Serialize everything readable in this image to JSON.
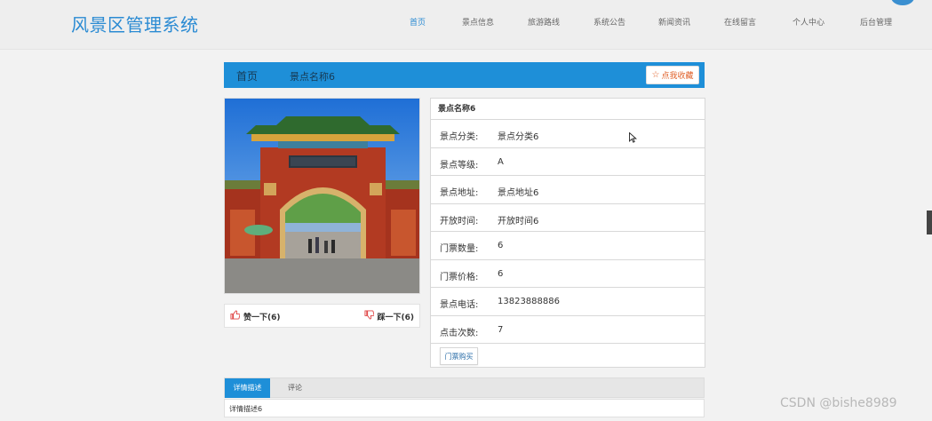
{
  "header": {
    "logo": "风景区管理系统",
    "nav": [
      {
        "label": "首页",
        "active": true
      },
      {
        "label": "景点信息",
        "active": false
      },
      {
        "label": "旅游路线",
        "active": false
      },
      {
        "label": "系统公告",
        "active": false
      },
      {
        "label": "新闻资讯",
        "active": false
      },
      {
        "label": "在线留言",
        "active": false
      },
      {
        "label": "个人中心",
        "active": false
      },
      {
        "label": "后台管理",
        "active": false
      }
    ],
    "accent_color": "#2b8bd3"
  },
  "breadcrumb": {
    "home": "首页",
    "current": "景点名称6",
    "favorite_label": "点我收藏",
    "favorite_icon": "star-outline-icon",
    "bar_color": "#1e8fd8"
  },
  "likes": {
    "like_label": "赞一下(6)",
    "like_icon": "thumbs-up-icon",
    "dislike_label": "踩一下(6)",
    "dislike_icon": "thumbs-down-icon"
  },
  "info": {
    "title": "景点名称6",
    "rows": [
      {
        "key": "景点分类:",
        "value": "景点分类6"
      },
      {
        "key": "景点等级:",
        "value": "A"
      },
      {
        "key": "景点地址:",
        "value": "景点地址6"
      },
      {
        "key": "开放时间:",
        "value": "开放时间6"
      },
      {
        "key": "门票数量:",
        "value": "6"
      },
      {
        "key": "门票价格:",
        "value": "6"
      },
      {
        "key": "景点电话:",
        "value": "13823888886"
      },
      {
        "key": "点击次数:",
        "value": "7"
      }
    ],
    "buy_label": "门票购买"
  },
  "tabs": {
    "items": [
      {
        "label": "详情描述",
        "active": true
      },
      {
        "label": "评论",
        "active": false
      }
    ],
    "content": "详情描述6"
  },
  "watermark": "CSDN @bishe8989"
}
